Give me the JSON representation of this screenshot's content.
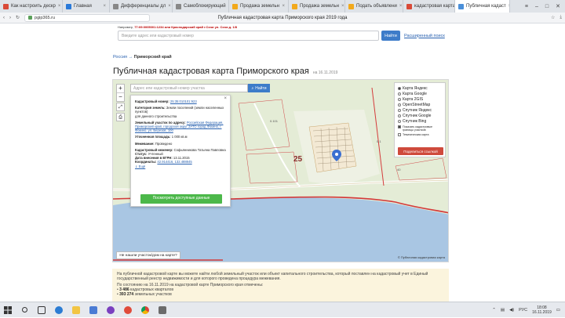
{
  "browser": {
    "tabs": [
      {
        "label": "Как настроить дескр",
        "color": "#d94a38",
        "active": false
      },
      {
        "label": "Главная",
        "color": "#2a7ad9",
        "active": false
      },
      {
        "label": "Дифференциалы дл",
        "color": "#888888",
        "active": false
      },
      {
        "label": "Самоблокирующий",
        "color": "#888888",
        "active": false
      },
      {
        "label": "Продажа земельн",
        "color": "#f2a91c",
        "active": false
      },
      {
        "label": "Продажа земельн",
        "color": "#f2a91c",
        "active": false
      },
      {
        "label": "Подать объявлени",
        "color": "#f2a91c",
        "active": false
      },
      {
        "label": "кадастровая карта",
        "color": "#d94a38",
        "active": false
      },
      {
        "label": "Публичная кадаст",
        "color": "#4a8fd9",
        "active": true
      }
    ],
    "address": "pgip365.ru",
    "page_title": "Публичная кадастровая карта Приморского края 2019 года"
  },
  "page": {
    "example_prefix": "Например,",
    "example_text": "77:09:0005001:1234 или Краснодарский край г.Сочи ул. Сочи д. 1/8",
    "search_placeholder": "Введите адрес или кадастровый номер",
    "search_button": "Найти",
    "advanced_search": "Расширенный поиск",
    "breadcrumb_root": "Россия",
    "breadcrumb_sep": "→",
    "breadcrumb_current": "Приморский край",
    "heading": "Публичная кадастровая карта Приморского края",
    "heading_date": "на 16.11.2019"
  },
  "map": {
    "search_placeholder": "Адрес или кадастровый номер участка",
    "search_button": "Найти",
    "zoom_in": "+",
    "zoom_out": "−",
    "block_number": "25",
    "number_labels": [
      "0.101",
      "0.1",
      "40"
    ],
    "layers": [
      {
        "label": "Карта Яндекс",
        "on": true
      },
      {
        "label": "Карта Google",
        "on": false
      },
      {
        "label": "Карта 2GIS",
        "on": false
      },
      {
        "label": "OpenStreetMap",
        "on": false
      },
      {
        "label": "Спутник Яндекс",
        "on": false
      },
      {
        "label": "Спутник Google",
        "on": false
      },
      {
        "label": "Спутник Bing",
        "on": false
      }
    ],
    "show_parcels": "Показать кадастровые границы участков",
    "thematic_map": "Тематическая карта",
    "share_button": "Поделиться ссылкой",
    "not_found": "Не нашли участок/дом на карте?",
    "copyright": "© Публичная кадастровая карта"
  },
  "info": {
    "cad_num_label": "Кадастровый номер:",
    "cad_num": "25:35:010101:923",
    "category_label": "Категория земель:",
    "category": "Земли поселений (земли населенных пунктов)",
    "use": "для данного строительства",
    "address_label": "Земельный участок по адресу:",
    "address": "Российская Федерация, Приморский край, городской округ ЗАТО город Фокино, г. Фокино, ул. Березов, 100",
    "area_label": "Уточненная площадь:",
    "area": "1 000 кв.м",
    "ownership_label": "Межевание:",
    "ownership": "Проведено",
    "engineer_label": "Кадастровый инженер:",
    "engineer": "Софьянникова Татьяна Павловна",
    "status_label": "Статус:",
    "status": "Учтенный",
    "date_label": "Дата внесения в ЕГРН:",
    "date": "13.11.2015",
    "coords_label": "Координаты:",
    "coords": "42.914416, 132.488845",
    "more": "⇓ Ещё",
    "button": "Посмотреть доступные данные",
    "close": "×"
  },
  "below": {
    "intro": "На публичной кадастровой карте вы можете найти любой земельный участок или объект капитального строительства, который поставлен на кадастровый учет в Единый государственный реестр недвижимости и для которого проведена процедура межевания.",
    "as_of": "По состоянию на 16.11.2019 на кадастровой карте Приморского края отмечены:",
    "stat1_num": "3 486",
    "stat1_txt": "кадастровых кварталов",
    "stat2_num": "393 274",
    "stat2_txt": "земельных участков"
  },
  "taskbar": {
    "lang": "РУС",
    "time": "18:08",
    "date": "16.11.2019"
  }
}
